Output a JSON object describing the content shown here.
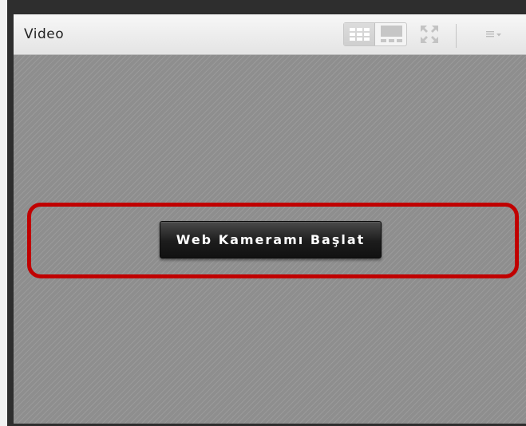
{
  "pod": {
    "title": "Video",
    "layout_buttons": [
      {
        "name": "grid-layout",
        "selected": true
      },
      {
        "name": "featured-layout",
        "selected": false
      }
    ],
    "fullscreen_icon": "fullscreen-icon",
    "menu_icon": "pod-menu-icon"
  },
  "stage": {
    "start_webcam_label": "Web Kameramı Başlat",
    "highlight_color": "#c00000"
  },
  "colors": {
    "frame": "#2e2e2e",
    "stage": "#8e8e8e",
    "button": "#1c1c1c"
  }
}
